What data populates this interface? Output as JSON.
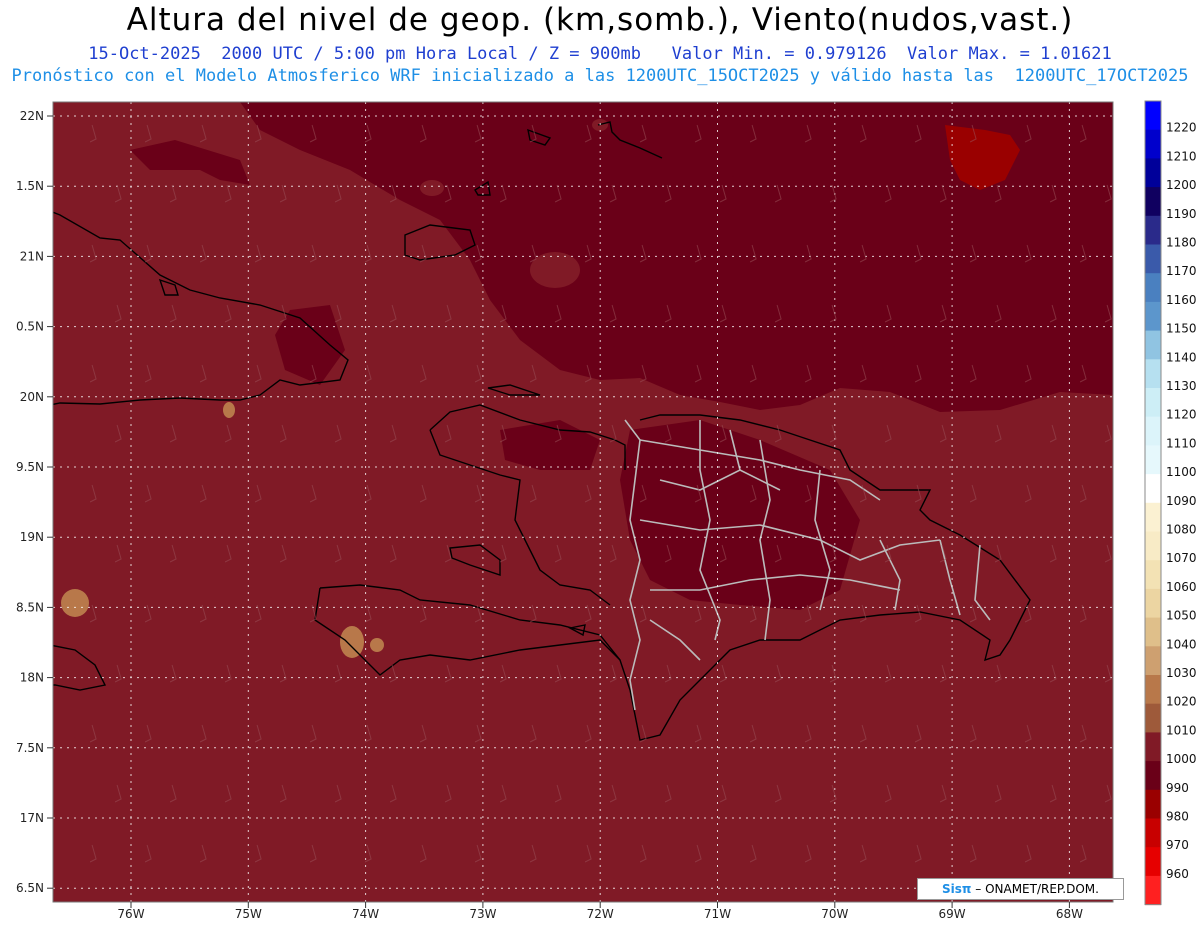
{
  "header": {
    "title": "Altura del nivel de geop. (km,somb.), Viento(nudos,vast.)",
    "line1": "15-Oct-2025  2000 UTC / 5:00 pm Hora Local / Z = 900mb   Valor Min. = 0.979126  Valor Max. = 1.01621",
    "line2": "Pronóstico con el Modelo Atmosferico WRF inicializado a las 1200UTC_15OCT2025 y válido hasta las  1200UTC_17OCT2025"
  },
  "map": {
    "lat_labels": [
      "22N",
      "1.5N",
      "21N",
      "0.5N",
      "20N",
      "9.5N",
      "19N",
      "8.5N",
      "18N",
      "7.5N",
      "17N",
      "6.5N"
    ],
    "lon_labels": [
      "76W",
      "75W",
      "74W",
      "73W",
      "72W",
      "71W",
      "70W",
      "69W",
      "68W"
    ],
    "colors": {
      "base": "#801a26",
      "dark": "#6a0018",
      "light": "#a0343a",
      "tan": "#b8784a",
      "border": "#bbbbbb",
      "coast": "#000000"
    }
  },
  "colorbar": {
    "levels": [
      "1220",
      "1210",
      "1200",
      "1190",
      "1180",
      "1170",
      "1160",
      "1150",
      "1140",
      "1130",
      "1120",
      "1110",
      "1100",
      "1090",
      "1080",
      "1070",
      "1060",
      "1050",
      "1040",
      "1030",
      "1020",
      "1010",
      "1000",
      "990",
      "980",
      "970",
      "960"
    ],
    "colors": [
      "#0000ff",
      "#0000cc",
      "#00009a",
      "#100060",
      "#2a2a8a",
      "#3a5aaa",
      "#4a80c0",
      "#5c96cc",
      "#90c4e2",
      "#b6e0f0",
      "#cdeef6",
      "#dcf4fa",
      "#e6f8fc",
      "#ffffff",
      "#fbf1d2",
      "#f8ebc6",
      "#f3e2b4",
      "#ecd5a2",
      "#dfbf8a",
      "#cea070",
      "#b8784a",
      "#9e5a3a",
      "#801a26",
      "#6a0018",
      "#9a0000",
      "#c80000",
      "#e60000",
      "#ff2020"
    ]
  },
  "credit": {
    "logo": "Sisπ",
    "text": "– ONAMET/REP.DOM."
  }
}
